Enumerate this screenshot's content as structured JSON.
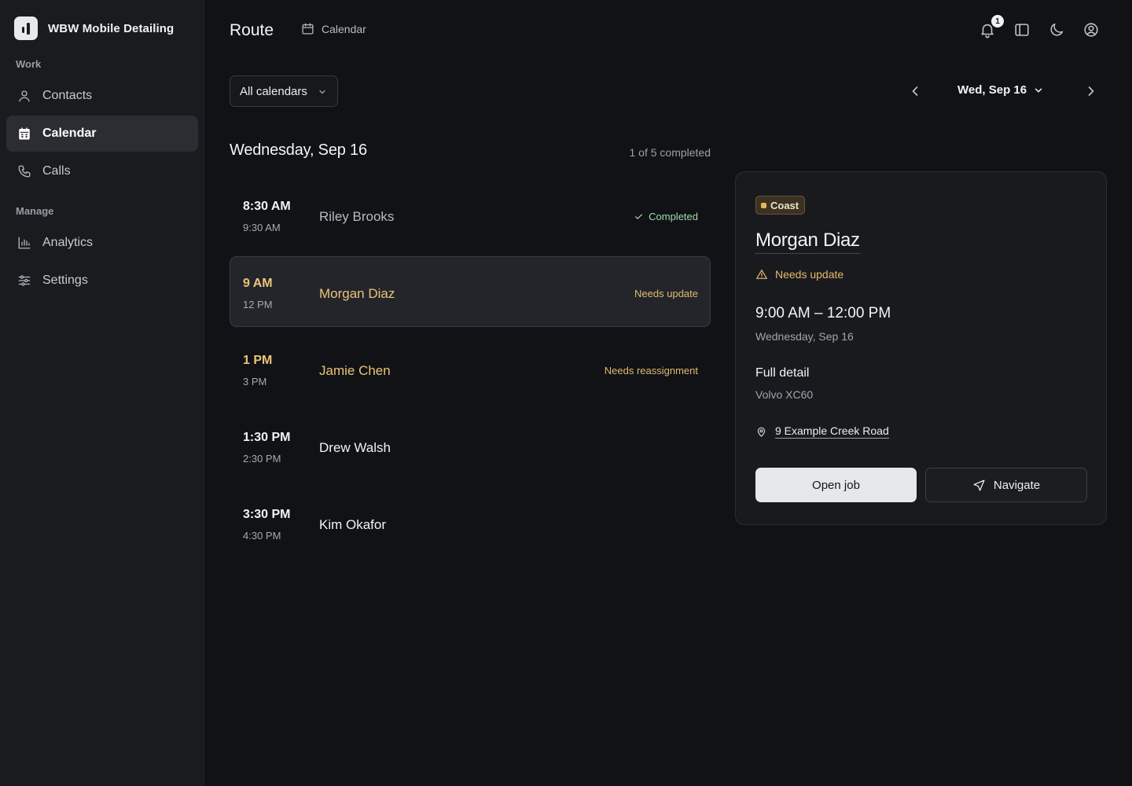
{
  "app": {
    "name": "WBW Mobile Detailing"
  },
  "sidebar": {
    "sections": [
      {
        "label": "Work"
      },
      {
        "label": "Manage"
      }
    ],
    "items": [
      {
        "label": "Contacts",
        "icon": "user-icon"
      },
      {
        "label": "Calendar",
        "icon": "calendar-icon",
        "active": true
      },
      {
        "label": "Calls",
        "icon": "phone-icon"
      },
      {
        "label": "Analytics",
        "icon": "bar-chart-icon"
      },
      {
        "label": "Settings",
        "icon": "sliders-icon"
      }
    ]
  },
  "header": {
    "title": "Route",
    "breadcrumb": "Calendar",
    "notifications_count": "1"
  },
  "filters": {
    "calendar_select": "All calendars"
  },
  "date_nav": {
    "current": "Wed, Sep 16"
  },
  "schedule": {
    "heading": "Wednesday, Sep 16",
    "progress": "1 of 5 completed",
    "jobs": [
      {
        "start": "8:30 AM",
        "end": "9:30 AM",
        "name": "Riley Brooks",
        "status": "Completed",
        "state": "done"
      },
      {
        "start": "9 AM",
        "end": "12 PM",
        "name": "Morgan Diaz",
        "status": "Needs update",
        "state": "warn",
        "selected": true
      },
      {
        "start": "1 PM",
        "end": "3 PM",
        "name": "Jamie Chen",
        "status": "Needs reassignment",
        "state": "warn"
      },
      {
        "start": "1:30 PM",
        "end": "2:30 PM",
        "name": "Drew Walsh",
        "status": "",
        "state": "normal"
      },
      {
        "start": "3:30 PM",
        "end": "4:30 PM",
        "name": "Kim Okafor",
        "status": "",
        "state": "normal"
      }
    ]
  },
  "detail": {
    "tag": "Coast",
    "name": "Morgan Diaz",
    "status": "Needs update",
    "time_range": "9:00 AM – 12:00 PM",
    "date": "Wednesday, Sep 16",
    "service": "Full detail",
    "vehicle": "Volvo XC60",
    "address": "9 Example Creek Road",
    "open_label": "Open job",
    "navigate_label": "Navigate"
  },
  "colors": {
    "background": "#111215",
    "sidebar": "#1a1b1f",
    "warning": "#ecc478",
    "success": "#9fdcaa"
  }
}
